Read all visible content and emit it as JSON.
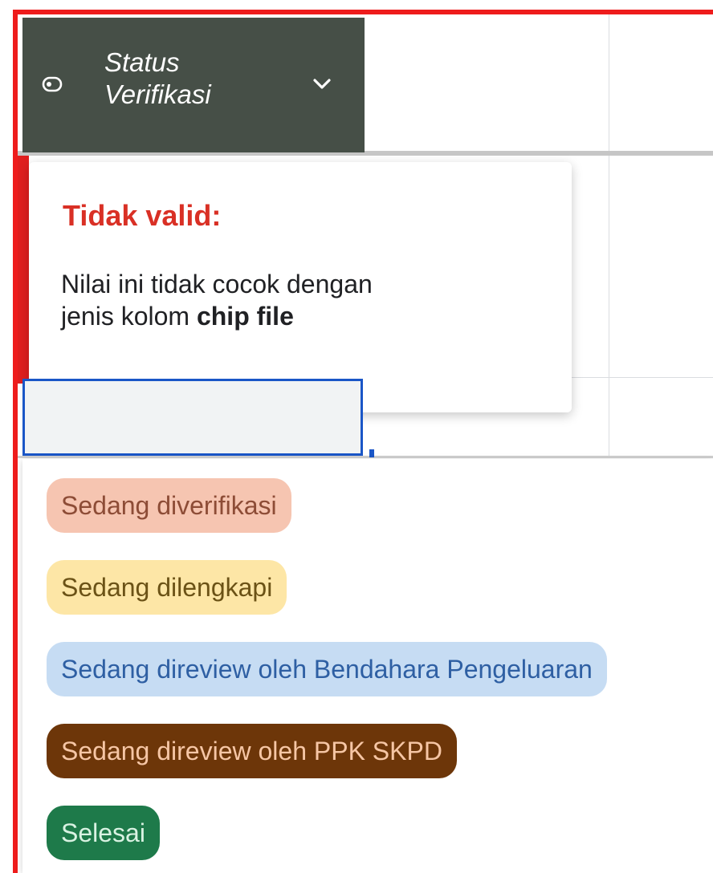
{
  "header": {
    "title_line1": "Status",
    "title_line2": "Verifikasi",
    "icon": "chip-icon",
    "dropdown_icon": "chevron-down-icon"
  },
  "tooltip": {
    "title": "Tidak valid:",
    "message_line1": "Nilai ini tidak cocok dengan",
    "message_prefix": "jenis kolom ",
    "message_bold": "chip file"
  },
  "dropdown": {
    "options": [
      {
        "label": "Sedang diverifikasi",
        "bg": "#f6c5b1",
        "fg": "#8d4c36"
      },
      {
        "label": "Sedang dilengkapi",
        "bg": "#fde6a6",
        "fg": "#6b5216"
      },
      {
        "label": "Sedang direview oleh Bendahara Pengeluaran",
        "bg": "#c6dcf3",
        "fg": "#2e5fa3"
      },
      {
        "label": "Sedang direview oleh PPK SKPD",
        "bg": "#6d3609",
        "fg": "#f6c6a5"
      },
      {
        "label": "Selesai",
        "bg": "#1e7a4a",
        "fg": "#d9f2e2"
      }
    ]
  },
  "colors": {
    "header_bg": "#464f47",
    "error_red": "#d93025",
    "focus_blue": "#1a56c7",
    "highlight_border": "#ee1c1c"
  }
}
